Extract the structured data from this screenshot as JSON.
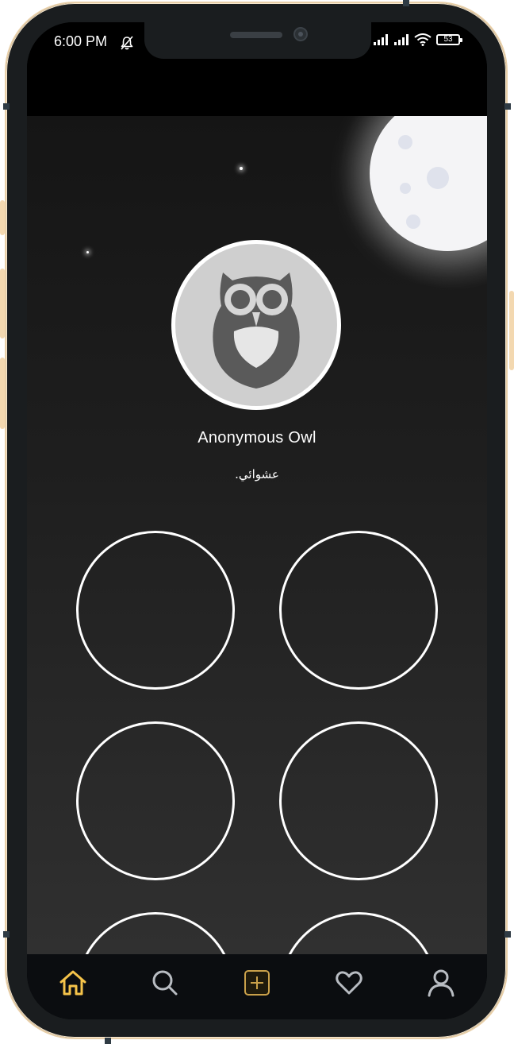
{
  "status_bar": {
    "time": "6:00 PM",
    "battery": "53",
    "icons": [
      "bell-off-icon",
      "signal-icon",
      "signal-icon",
      "wifi-icon",
      "battery-icon"
    ]
  },
  "profile": {
    "name": "Anonymous Owl",
    "bio": "عشوائي."
  },
  "slots": [
    "empty",
    "empty",
    "empty",
    "empty",
    "empty",
    "empty"
  ],
  "bottom_nav": {
    "items": [
      {
        "name": "home",
        "icon": "home-icon",
        "active": true
      },
      {
        "name": "search",
        "icon": "search-icon",
        "active": false
      },
      {
        "name": "add",
        "icon": "plus-square-icon",
        "active": false
      },
      {
        "name": "favorites",
        "icon": "heart-icon",
        "active": false
      },
      {
        "name": "profile",
        "icon": "user-icon",
        "active": false
      }
    ]
  },
  "colors": {
    "accent": "#f5c34a",
    "nav_icon": "#b8bcc2",
    "background_top": "#151515",
    "background_bottom": "#303030"
  }
}
